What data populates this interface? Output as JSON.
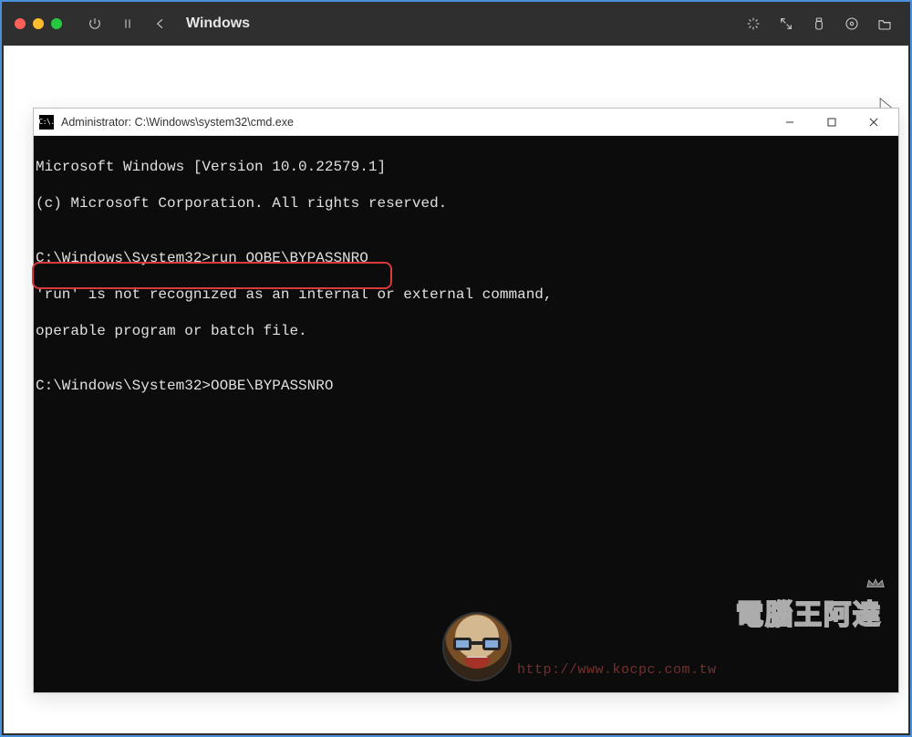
{
  "vm": {
    "title": "Windows"
  },
  "cmd": {
    "icon_text": "C:\\.",
    "title": "Administrator: C:\\Windows\\system32\\cmd.exe",
    "lines": {
      "l1": "Microsoft Windows [Version 10.0.22579.1]",
      "l2": "(c) Microsoft Corporation. All rights reserved.",
      "l3": "",
      "l4": "C:\\Windows\\System32>run OOBE\\BYPASSNRO",
      "l5": "'run' is not recognized as an internal or external command,",
      "l6": "operable program or batch file.",
      "l7": "",
      "l8": "C:\\Windows\\System32>OOBE\\BYPASSNRO"
    }
  },
  "watermark": {
    "title": "電腦王阿達",
    "url": "http://www.kocpc.com.tw"
  }
}
